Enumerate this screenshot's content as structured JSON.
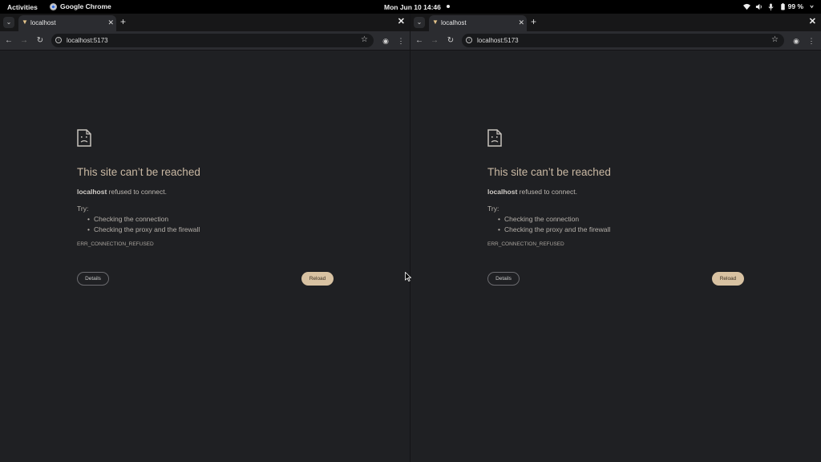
{
  "topbar": {
    "activities": "Activities",
    "app_name": "Google Chrome",
    "clock": "Mon Jun 10  14:46",
    "battery": "99 %"
  },
  "windows": [
    {
      "tab_title": "localhost",
      "url": "localhost:5173",
      "error": {
        "heading": "This site can’t be reached",
        "host": "localhost",
        "message": " refused to connect.",
        "try_label": "Try:",
        "suggestions": [
          "Checking the connection",
          "Checking the proxy and the firewall"
        ],
        "code": "ERR_CONNECTION_REFUSED",
        "details_label": "Details",
        "reload_label": "Reload"
      }
    },
    {
      "tab_title": "localhost",
      "url": "localhost:5173",
      "error": {
        "heading": "This site can’t be reached",
        "host": "localhost",
        "message": " refused to connect.",
        "try_label": "Try:",
        "suggestions": [
          "Checking the connection",
          "Checking the proxy and the firewall"
        ],
        "code": "ERR_CONNECTION_REFUSED",
        "details_label": "Details",
        "reload_label": "Reload"
      }
    }
  ],
  "colors": {
    "accent": "#d8c2a2",
    "heading": "#c9b8a3",
    "background": "#1f2023"
  },
  "icons": [
    "chevron-down-icon",
    "vite-favicon-icon",
    "close-icon",
    "plus-icon",
    "back-icon",
    "forward-icon",
    "reload-icon",
    "info-icon",
    "star-icon",
    "extension-icon",
    "kebab-menu-icon",
    "sad-page-icon",
    "wifi-icon",
    "volume-icon",
    "mic-icon",
    "battery-icon"
  ]
}
